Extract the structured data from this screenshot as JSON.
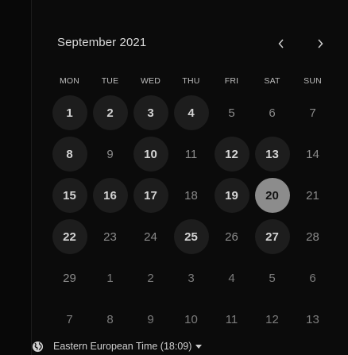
{
  "header": {
    "month_title": "September 2021"
  },
  "weekdays": [
    "MON",
    "TUE",
    "WED",
    "THU",
    "FRI",
    "SAT",
    "SUN"
  ],
  "days": [
    {
      "label": "1",
      "state": "available"
    },
    {
      "label": "2",
      "state": "available"
    },
    {
      "label": "3",
      "state": "available"
    },
    {
      "label": "4",
      "state": "available"
    },
    {
      "label": "5",
      "state": "unavailable"
    },
    {
      "label": "6",
      "state": "unavailable"
    },
    {
      "label": "7",
      "state": "unavailable"
    },
    {
      "label": "8",
      "state": "available"
    },
    {
      "label": "9",
      "state": "unavailable"
    },
    {
      "label": "10",
      "state": "available"
    },
    {
      "label": "11",
      "state": "unavailable"
    },
    {
      "label": "12",
      "state": "available"
    },
    {
      "label": "13",
      "state": "available"
    },
    {
      "label": "14",
      "state": "unavailable"
    },
    {
      "label": "15",
      "state": "available"
    },
    {
      "label": "16",
      "state": "available"
    },
    {
      "label": "17",
      "state": "available"
    },
    {
      "label": "18",
      "state": "unavailable"
    },
    {
      "label": "19",
      "state": "available"
    },
    {
      "label": "20",
      "state": "selected"
    },
    {
      "label": "21",
      "state": "unavailable"
    },
    {
      "label": "22",
      "state": "available"
    },
    {
      "label": "23",
      "state": "unavailable"
    },
    {
      "label": "24",
      "state": "unavailable"
    },
    {
      "label": "25",
      "state": "available"
    },
    {
      "label": "26",
      "state": "unavailable"
    },
    {
      "label": "27",
      "state": "available"
    },
    {
      "label": "28",
      "state": "unavailable"
    },
    {
      "label": "29",
      "state": "unavailable"
    },
    {
      "label": "1",
      "state": "muted"
    },
    {
      "label": "2",
      "state": "muted"
    },
    {
      "label": "3",
      "state": "muted"
    },
    {
      "label": "4",
      "state": "muted"
    },
    {
      "label": "5",
      "state": "muted"
    },
    {
      "label": "6",
      "state": "muted"
    },
    {
      "label": "7",
      "state": "muted"
    },
    {
      "label": "8",
      "state": "muted"
    },
    {
      "label": "9",
      "state": "muted"
    },
    {
      "label": "10",
      "state": "muted"
    },
    {
      "label": "11",
      "state": "muted"
    },
    {
      "label": "12",
      "state": "muted"
    },
    {
      "label": "13",
      "state": "muted"
    }
  ],
  "timezone": {
    "label": "Eastern European Time (18:09)",
    "icon": "globe-icon"
  },
  "icons": {
    "prev": "chevron-left-icon",
    "next": "chevron-right-icon",
    "caret": "caret-down-icon"
  },
  "colors": {
    "background": "#0b0b0b",
    "available_circle": "#1d1d1d",
    "selected_circle": "#8c8c8c"
  }
}
